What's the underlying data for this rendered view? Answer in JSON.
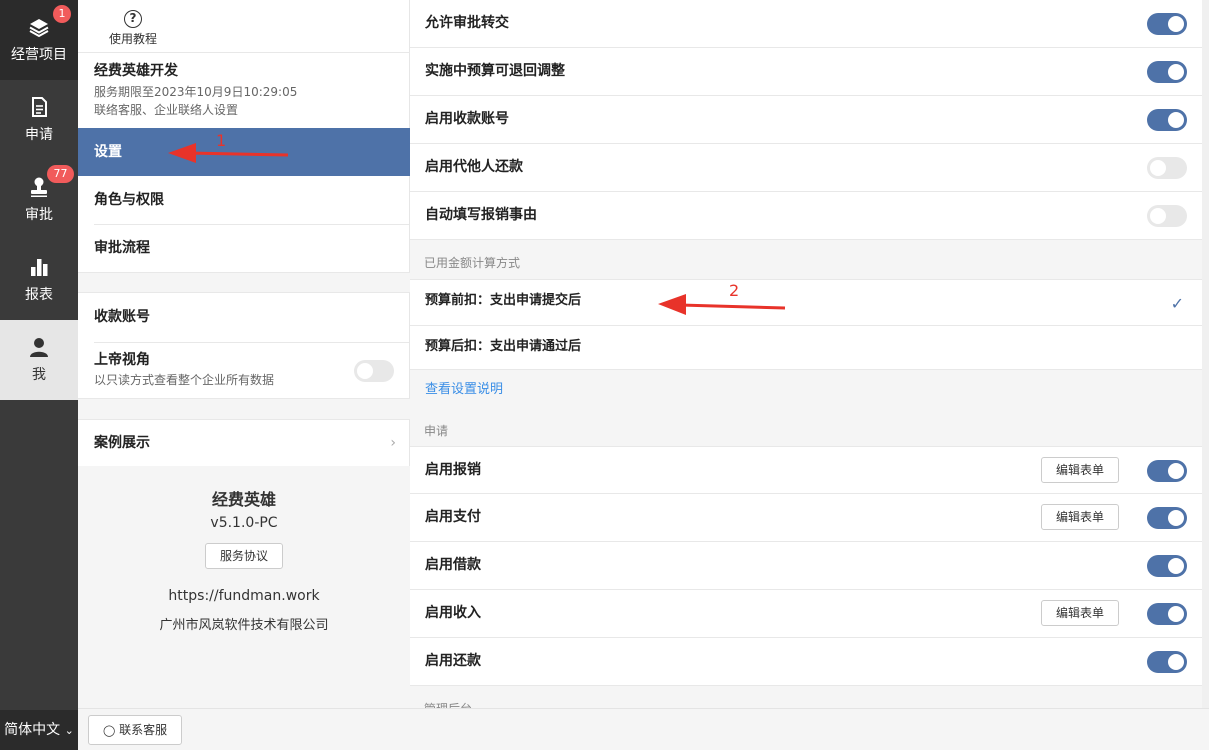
{
  "nav": {
    "items": [
      {
        "label": "经营项目",
        "icon": "layers-icon",
        "badge": "1"
      },
      {
        "label": "申请",
        "icon": "document-icon",
        "badge": ""
      },
      {
        "label": "审批",
        "icon": "stamp-icon",
        "badge": "77"
      },
      {
        "label": "报表",
        "icon": "bar-chart-icon",
        "badge": ""
      },
      {
        "label": "我",
        "icon": "user-icon",
        "badge": ""
      }
    ],
    "language": "简体中文"
  },
  "mid": {
    "tutorial": "使用教程",
    "org_name": "经费英雄开发",
    "service_period": "服务期限至2023年10月9日10:29:05",
    "contact_setting": "联络客服、企业联络人设置",
    "menu": {
      "settings": "设置",
      "roles": "角色与权限",
      "flow": "审批流程",
      "accounts": "收款账号",
      "god_view": "上帝视角",
      "god_view_desc": "以只读方式查看整个企业所有数据",
      "cases": "案例展示"
    },
    "brand": {
      "name": "经费英雄",
      "version": "v5.1.0-PC",
      "agreement": "服务协议",
      "url": "https://fundman.work",
      "company": "广州市风岚软件技术有限公司"
    }
  },
  "right": {
    "toggles_top": [
      {
        "label": "允许审批转交",
        "on": true
      },
      {
        "label": "实施中预算可退回调整",
        "on": true
      },
      {
        "label": "启用收款账号",
        "on": true
      },
      {
        "label": "启用代他人还款",
        "on": false
      },
      {
        "label": "自动填写报销事由",
        "on": false
      }
    ],
    "calc_section": "已用金额计算方式",
    "calc_options": [
      {
        "label": "预算前扣：支出申请提交后",
        "selected": true
      },
      {
        "label": "预算后扣：支出申请通过后",
        "selected": false
      }
    ],
    "help_link": "查看设置说明",
    "apply_section": "申请",
    "apply_rows": [
      {
        "label": "启用报销",
        "edit": "编辑表单",
        "on": true
      },
      {
        "label": "启用支付",
        "edit": "编辑表单",
        "on": true
      },
      {
        "label": "启用借款",
        "edit": "",
        "on": true
      },
      {
        "label": "启用收入",
        "edit": "编辑表单",
        "on": true
      },
      {
        "label": "启用还款",
        "edit": "",
        "on": true
      }
    ],
    "cut_section": "管理后台"
  },
  "footer": {
    "contact": "联系客服"
  },
  "annotations": {
    "one": "1",
    "two": "2"
  },
  "colors": {
    "accent": "#4e72a8",
    "badge": "#f15b5b",
    "nav_bg": "#3a3a3a",
    "link": "#3a8ee6"
  }
}
